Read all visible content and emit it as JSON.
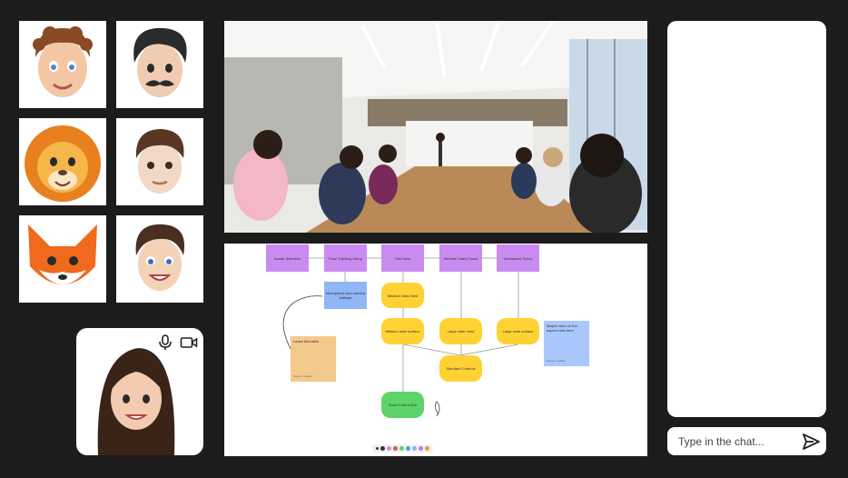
{
  "participants": [
    {
      "name_icon": "memoji-curly-hair-icon"
    },
    {
      "name_icon": "memoji-mustache-icon"
    },
    {
      "name_icon": "memoji-lion-icon"
    },
    {
      "name_icon": "memoji-short-hair-icon"
    },
    {
      "name_icon": "memoji-fox-icon"
    },
    {
      "name_icon": "memoji-smiling-man-icon"
    }
  ],
  "self_view": {
    "mic_icon": "microphone-icon",
    "camera_icon": "video-camera-icon"
  },
  "whiteboard": {
    "nodes": [
      {
        "text": "Avatar Selection"
      },
      {
        "text": "Face Tracking Setup"
      },
      {
        "text": "Grid View"
      },
      {
        "text": "Website Video Focus"
      },
      {
        "text": "Workspace Focus"
      },
      {
        "text": "Microphone and camera settings"
      },
      {
        "text": "Medium video feed"
      },
      {
        "text": "Medium work surface"
      },
      {
        "text": "Large video feed"
      },
      {
        "text": "Large work surface"
      },
      {
        "text": "Standard Controls"
      },
      {
        "text": "Show Control Bar"
      }
    ],
    "notes": [
      {
        "text": "Leave this table",
        "footer": "Source: header"
      },
      {
        "text": "Maybe work on the aspect ratio here",
        "footer": "Source: header"
      }
    ],
    "toolbar_colors": [
      "#333333",
      "#c98bf0",
      "#e05555",
      "#5dd46a",
      "#3ab0d8",
      "#8fb6f7",
      "#b77ee8",
      "#f0a030"
    ]
  },
  "chat": {
    "placeholder": "Type in the chat...",
    "send_icon": "send-icon"
  }
}
